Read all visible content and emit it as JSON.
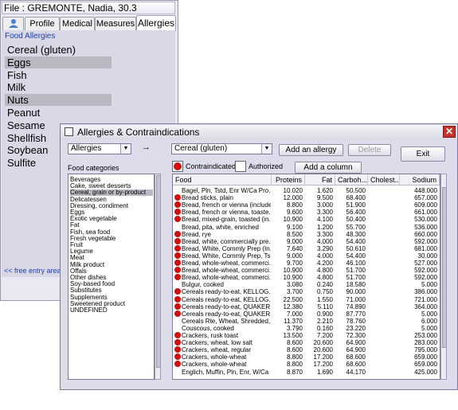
{
  "patient_window": {
    "title": "File : GREMONTE, Nadia, 30.3",
    "tabs": [
      "Profile",
      "Medical",
      "Measures",
      "Allergies"
    ],
    "active_tab": "Allergies",
    "section_label": "Food Allergies",
    "allergies": [
      "Cereal (gluten)",
      "Eggs",
      "Fish",
      "Milk",
      "Nuts",
      "Peanut",
      "Sesame",
      "Shellfish",
      "Soybean",
      "Sulfite"
    ],
    "selected_allergies": [
      "Eggs",
      "Nuts"
    ],
    "free_entry_label": "<< free entry area"
  },
  "dialog": {
    "title": "Allergies & Contraindications",
    "type_combo": "Allergies",
    "arrow": "→",
    "allergen_combo": "Cereal (gluten)",
    "add_allergy_label": "Add an allergy",
    "delete_label": "Delete",
    "exit_label": "Exit",
    "contraindicated_label": "Contraindicated",
    "authorized_label": "Authorized",
    "add_column_label": "Add a column",
    "food_categories_label": "Food categories",
    "categories": [
      "Beverages",
      "Cake, sweet desserts",
      "Cereal, grain or by-product",
      "Delicatessen",
      "Dressing, condiment",
      "Eggs",
      "Exotic vegetable",
      "Fat",
      "Fish, sea food",
      "Fresh vegetable",
      "Fruit",
      "Legume",
      "Meat",
      "Milk product",
      "Offals",
      "Other dishes",
      "Soy-based food",
      "Substitutes",
      "Supplements",
      "Sweetened product",
      "UNDEFINED"
    ],
    "selected_category": "Cereal, grain or by-product",
    "columns": [
      "Food",
      "Proteins",
      "Fat",
      "Carboh...",
      "Cholest...",
      "Sodium"
    ],
    "rows": [
      {
        "food": "Bagel, Pln, Tstd, Enr W/Ca Pro...",
        "proteins": "10.020",
        "fat": "1.620",
        "carb": "50.500",
        "chol": "",
        "sodium": "448.000",
        "flag": false
      },
      {
        "food": "Bread sticks, plain",
        "proteins": "12.000",
        "fat": "9.500",
        "carb": "68.400",
        "chol": "",
        "sodium": "657.000",
        "flag": true
      },
      {
        "food": "Bread, french or vienna (include...",
        "proteins": "8.800",
        "fat": "3.000",
        "carb": "51.900",
        "chol": "",
        "sodium": "609.000",
        "flag": true
      },
      {
        "food": "Bread, french or vienna, toaste...",
        "proteins": "9.600",
        "fat": "3.300",
        "carb": "56.400",
        "chol": "",
        "sodium": "661.000",
        "flag": true
      },
      {
        "food": "Bread, mixed-grain, toasted (in...",
        "proteins": "10.900",
        "fat": "4.100",
        "carb": "50.400",
        "chol": "",
        "sodium": "530.000",
        "flag": true
      },
      {
        "food": "Bread, pita, white, enriched",
        "proteins": "9.100",
        "fat": "1.200",
        "carb": "55.700",
        "chol": "",
        "sodium": "536.000",
        "flag": false
      },
      {
        "food": "Bread, rye",
        "proteins": "8.500",
        "fat": "3.300",
        "carb": "48.300",
        "chol": "",
        "sodium": "660.000",
        "flag": true
      },
      {
        "food": "Bread, white, commercially pre...",
        "proteins": "9.000",
        "fat": "4.000",
        "carb": "54.400",
        "chol": "",
        "sodium": "592.000",
        "flag": true
      },
      {
        "food": "Bread, White, Commly Prep (In...",
        "proteins": "7.640",
        "fat": "3.290",
        "carb": "50.610",
        "chol": "",
        "sodium": "681.000",
        "flag": true
      },
      {
        "food": "Bread, White, Commly Prep, Ts...",
        "proteins": "9.000",
        "fat": "4.000",
        "carb": "54.400",
        "chol": "",
        "sodium": "30.000",
        "flag": true
      },
      {
        "food": "Bread, whole-wheat, commerci...",
        "proteins": "9.700",
        "fat": "4.200",
        "carb": "46.100",
        "chol": "",
        "sodium": "527.000",
        "flag": true
      },
      {
        "food": "Bread, whole-wheat, commerci...",
        "proteins": "10.900",
        "fat": "4.800",
        "carb": "51.700",
        "chol": "",
        "sodium": "592.000",
        "flag": true
      },
      {
        "food": "Bread, whole-wheat, commerci...",
        "proteins": "10.900",
        "fat": "4.800",
        "carb": "51.700",
        "chol": "",
        "sodium": "592.000",
        "flag": true
      },
      {
        "food": "Bulgur, cooked",
        "proteins": "3.080",
        "fat": "0.240",
        "carb": "18.580",
        "chol": "",
        "sodium": "5.000",
        "flag": false
      },
      {
        "food": "Cereals ready-to-eat, KELLOG...",
        "proteins": "3.700",
        "fat": "0.750",
        "carb": "90.000",
        "chol": "",
        "sodium": "386.000",
        "flag": true
      },
      {
        "food": "Cereals ready-to-eat, KELLOG...",
        "proteins": "22.500",
        "fat": "1.550",
        "carb": "71.000",
        "chol": "",
        "sodium": "721.000",
        "flag": true
      },
      {
        "food": "Cereals ready-to-eat, QUAKER...",
        "proteins": "12.380",
        "fat": "5.110",
        "carb": "74.890",
        "chol": "",
        "sodium": "364.000",
        "flag": true
      },
      {
        "food": "Cereals ready-to-eat, QUAKER...",
        "proteins": "7.000",
        "fat": "0.900",
        "carb": "87.770",
        "chol": "",
        "sodium": "5.000",
        "flag": true
      },
      {
        "food": "Cereals Rte, Wheat, Shredded,...",
        "proteins": "11.370",
        "fat": "2.210",
        "carb": "78.760",
        "chol": "",
        "sodium": "6.000",
        "flag": false
      },
      {
        "food": "Couscous, cooked",
        "proteins": "3.790",
        "fat": "0.160",
        "carb": "23.220",
        "chol": "",
        "sodium": "5.000",
        "flag": false
      },
      {
        "food": "Crackers, rusk toast",
        "proteins": "13.500",
        "fat": "7.200",
        "carb": "72.300",
        "chol": "",
        "sodium": "253.000",
        "flag": true
      },
      {
        "food": "Crackers, wheat, low salt",
        "proteins": "8.600",
        "fat": "20.600",
        "carb": "64.900",
        "chol": "",
        "sodium": "283.000",
        "flag": true
      },
      {
        "food": "Crackers, wheat, regular",
        "proteins": "8.600",
        "fat": "20.600",
        "carb": "64.900",
        "chol": "",
        "sodium": "795.000",
        "flag": true
      },
      {
        "food": "Crackers, whole-wheat",
        "proteins": "8.800",
        "fat": "17.200",
        "carb": "68.600",
        "chol": "",
        "sodium": "659.000",
        "flag": true
      },
      {
        "food": "Crackers, whole-wheat",
        "proteins": "8.800",
        "fat": "17.200",
        "carb": "68.600",
        "chol": "",
        "sodium": "659.000",
        "flag": true
      },
      {
        "food": "Englich, Muffin, Pln, Enr, W/Ca P...",
        "proteins": "8.870",
        "fat": "1.690",
        "carb": "44.170",
        "chol": "",
        "sodium": "425.000",
        "flag": false
      }
    ]
  },
  "colors": {
    "contraindicated": "#d01010",
    "selection": "#b9b9c4",
    "label_blue": "#1f3fb0",
    "close_red": "#c8302a"
  }
}
